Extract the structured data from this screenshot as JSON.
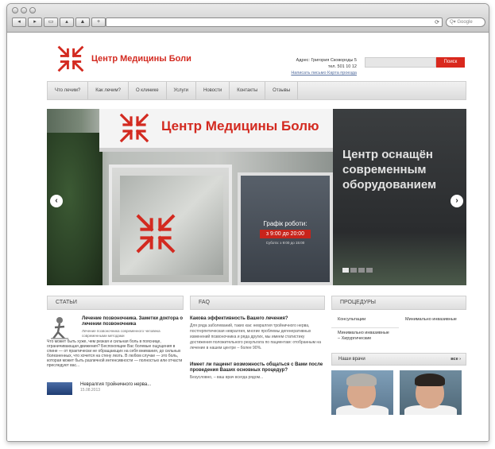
{
  "browser": {
    "nav_buttons": [
      "◂",
      "▸",
      "▭",
      "▴",
      "▲",
      "+"
    ],
    "reload_icon": "⟳",
    "search_placeholder": "Q▾ Google"
  },
  "site": {
    "logo_text": "Центр Медицины Боли",
    "address_line1": "Адрес: Григория Сковороды 5",
    "address_line2": "тел. 501 10 12",
    "links": "Написать письмо   Карта проезда",
    "search_button": "Поиск",
    "nav": [
      "Что лечим?",
      "Как лечим?",
      "О клинике",
      "Услуги",
      "Новости",
      "Контакты",
      "Отзывы"
    ]
  },
  "slider": {
    "sign_text": "Центр Медицины Болю",
    "caption": "Центр оснащён современным оборудованием",
    "schedule_title": "Графік роботи:",
    "schedule_hours": "з 9:00 до 20:00",
    "schedule_note": "Субота: з 9:00 до 15:00",
    "prev": "‹",
    "next": "›",
    "dots_active": 1
  },
  "articles": {
    "header": "СТАТЬИ",
    "item1_title": "Лечение позвоночника. Заметки доктора о лечении позвоночника",
    "item1_sub": "Лечение позвоночника современного человека современными методами",
    "item1_body": "Что может быть хуже, чем резкая и сильная боль в пояснице, ограничивающая движения? Беспокоящие Вас болевые ощущения в спине — от практически не обращающих на себя внимания, до сильных болезненных, что хочется на стену лезть. В любом случае — это боль, которая может быть различной интенсивности — полностью или отчасти преследуют вас...",
    "item2_title": "Невралгия тройничного нерва...",
    "item2_date": "15.08.2013"
  },
  "faq": {
    "header": "FAQ",
    "q1": "Какова эффективность Вашего лечения?",
    "a1": "Для ряда заболеваний, таких как: невралгия тройничного нерва, постгерпетическая невралгия, многие проблемы дегенеративных изменений позвоночника и ряда других, мы имеем статистику достижения положительного результата по пациентам: отобранным на лечение в нашем центре – более 90%.",
    "q2": "Имеет ли пациент возможность общаться с Вами после проведения Ваших основных процедур?",
    "a2": "Безусловно, – ваш врач всегда рядом..."
  },
  "procedures": {
    "header": "ПРОЦЕДУРЫ",
    "items": [
      "Консультации",
      "Минимально инвазивные",
      "Минимально инвазивные – Хирургические",
      ""
    ],
    "doctors_header": "Наши врачи",
    "doctors_all": "все ›"
  }
}
